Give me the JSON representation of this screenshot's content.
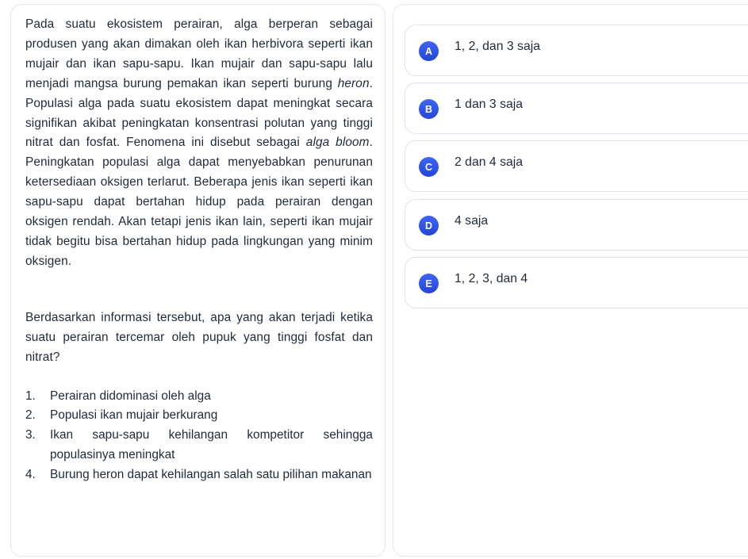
{
  "question": {
    "paragraph_pre_heron": "Pada suatu ekosistem perairan, alga berperan sebagai produsen yang akan dimakan oleh ikan herbivora seperti ikan mujair dan ikan sapu-sapu. Ikan mujair dan sapu-sapu lalu menjadi mangsa burung pemakan ikan seperti burung ",
    "heron_term": "heron",
    "paragraph_mid": ". Populasi alga pada suatu ekosistem dapat meningkat secara signifikan akibat peningkatan konsentrasi polutan yang tinggi nitrat dan fosfat. Fenomena ini disebut sebagai ",
    "alga_bloom_term": "alga bloom",
    "paragraph_post": ". Peningkatan populasi alga dapat menyebabkan penurunan ketersediaan oksigen terlarut. Beberapa jenis ikan seperti ikan sapu-sapu dapat bertahan hidup pada perairan dengan oksigen rendah. Akan tetapi jenis ikan lain, seperti ikan mujair tidak begitu bisa bertahan hidup pada lingkungan yang minim oksigen.",
    "prompt": "Berdasarkan informasi tersebut, apa yang akan terjadi ketika suatu perairan tercemar oleh pupuk yang tinggi fosfat dan nitrat?",
    "statements": [
      {
        "num": "1.",
        "text": "Perairan didominasi oleh alga"
      },
      {
        "num": "2.",
        "text": "Populasi ikan mujair berkurang"
      },
      {
        "num": "3.",
        "text": "Ikan sapu-sapu kehilangan kompetitor sehingga populasinya meningkat"
      },
      {
        "num": "4.",
        "text": "Burung heron dapat kehilangan salah satu pilihan makanan"
      }
    ]
  },
  "options": [
    {
      "letter": "A",
      "text": "1, 2, dan 3 saja"
    },
    {
      "letter": "B",
      "text": "1 dan 3 saja"
    },
    {
      "letter": "C",
      "text": "2 dan 4 saja"
    },
    {
      "letter": "D",
      "text": "4 saja"
    },
    {
      "letter": "E",
      "text": "1, 2, 3, dan 4"
    }
  ],
  "colors": {
    "badge": "#2f52e8",
    "card_border": "#e5e7eb",
    "option_border": "#dbe3f5"
  }
}
